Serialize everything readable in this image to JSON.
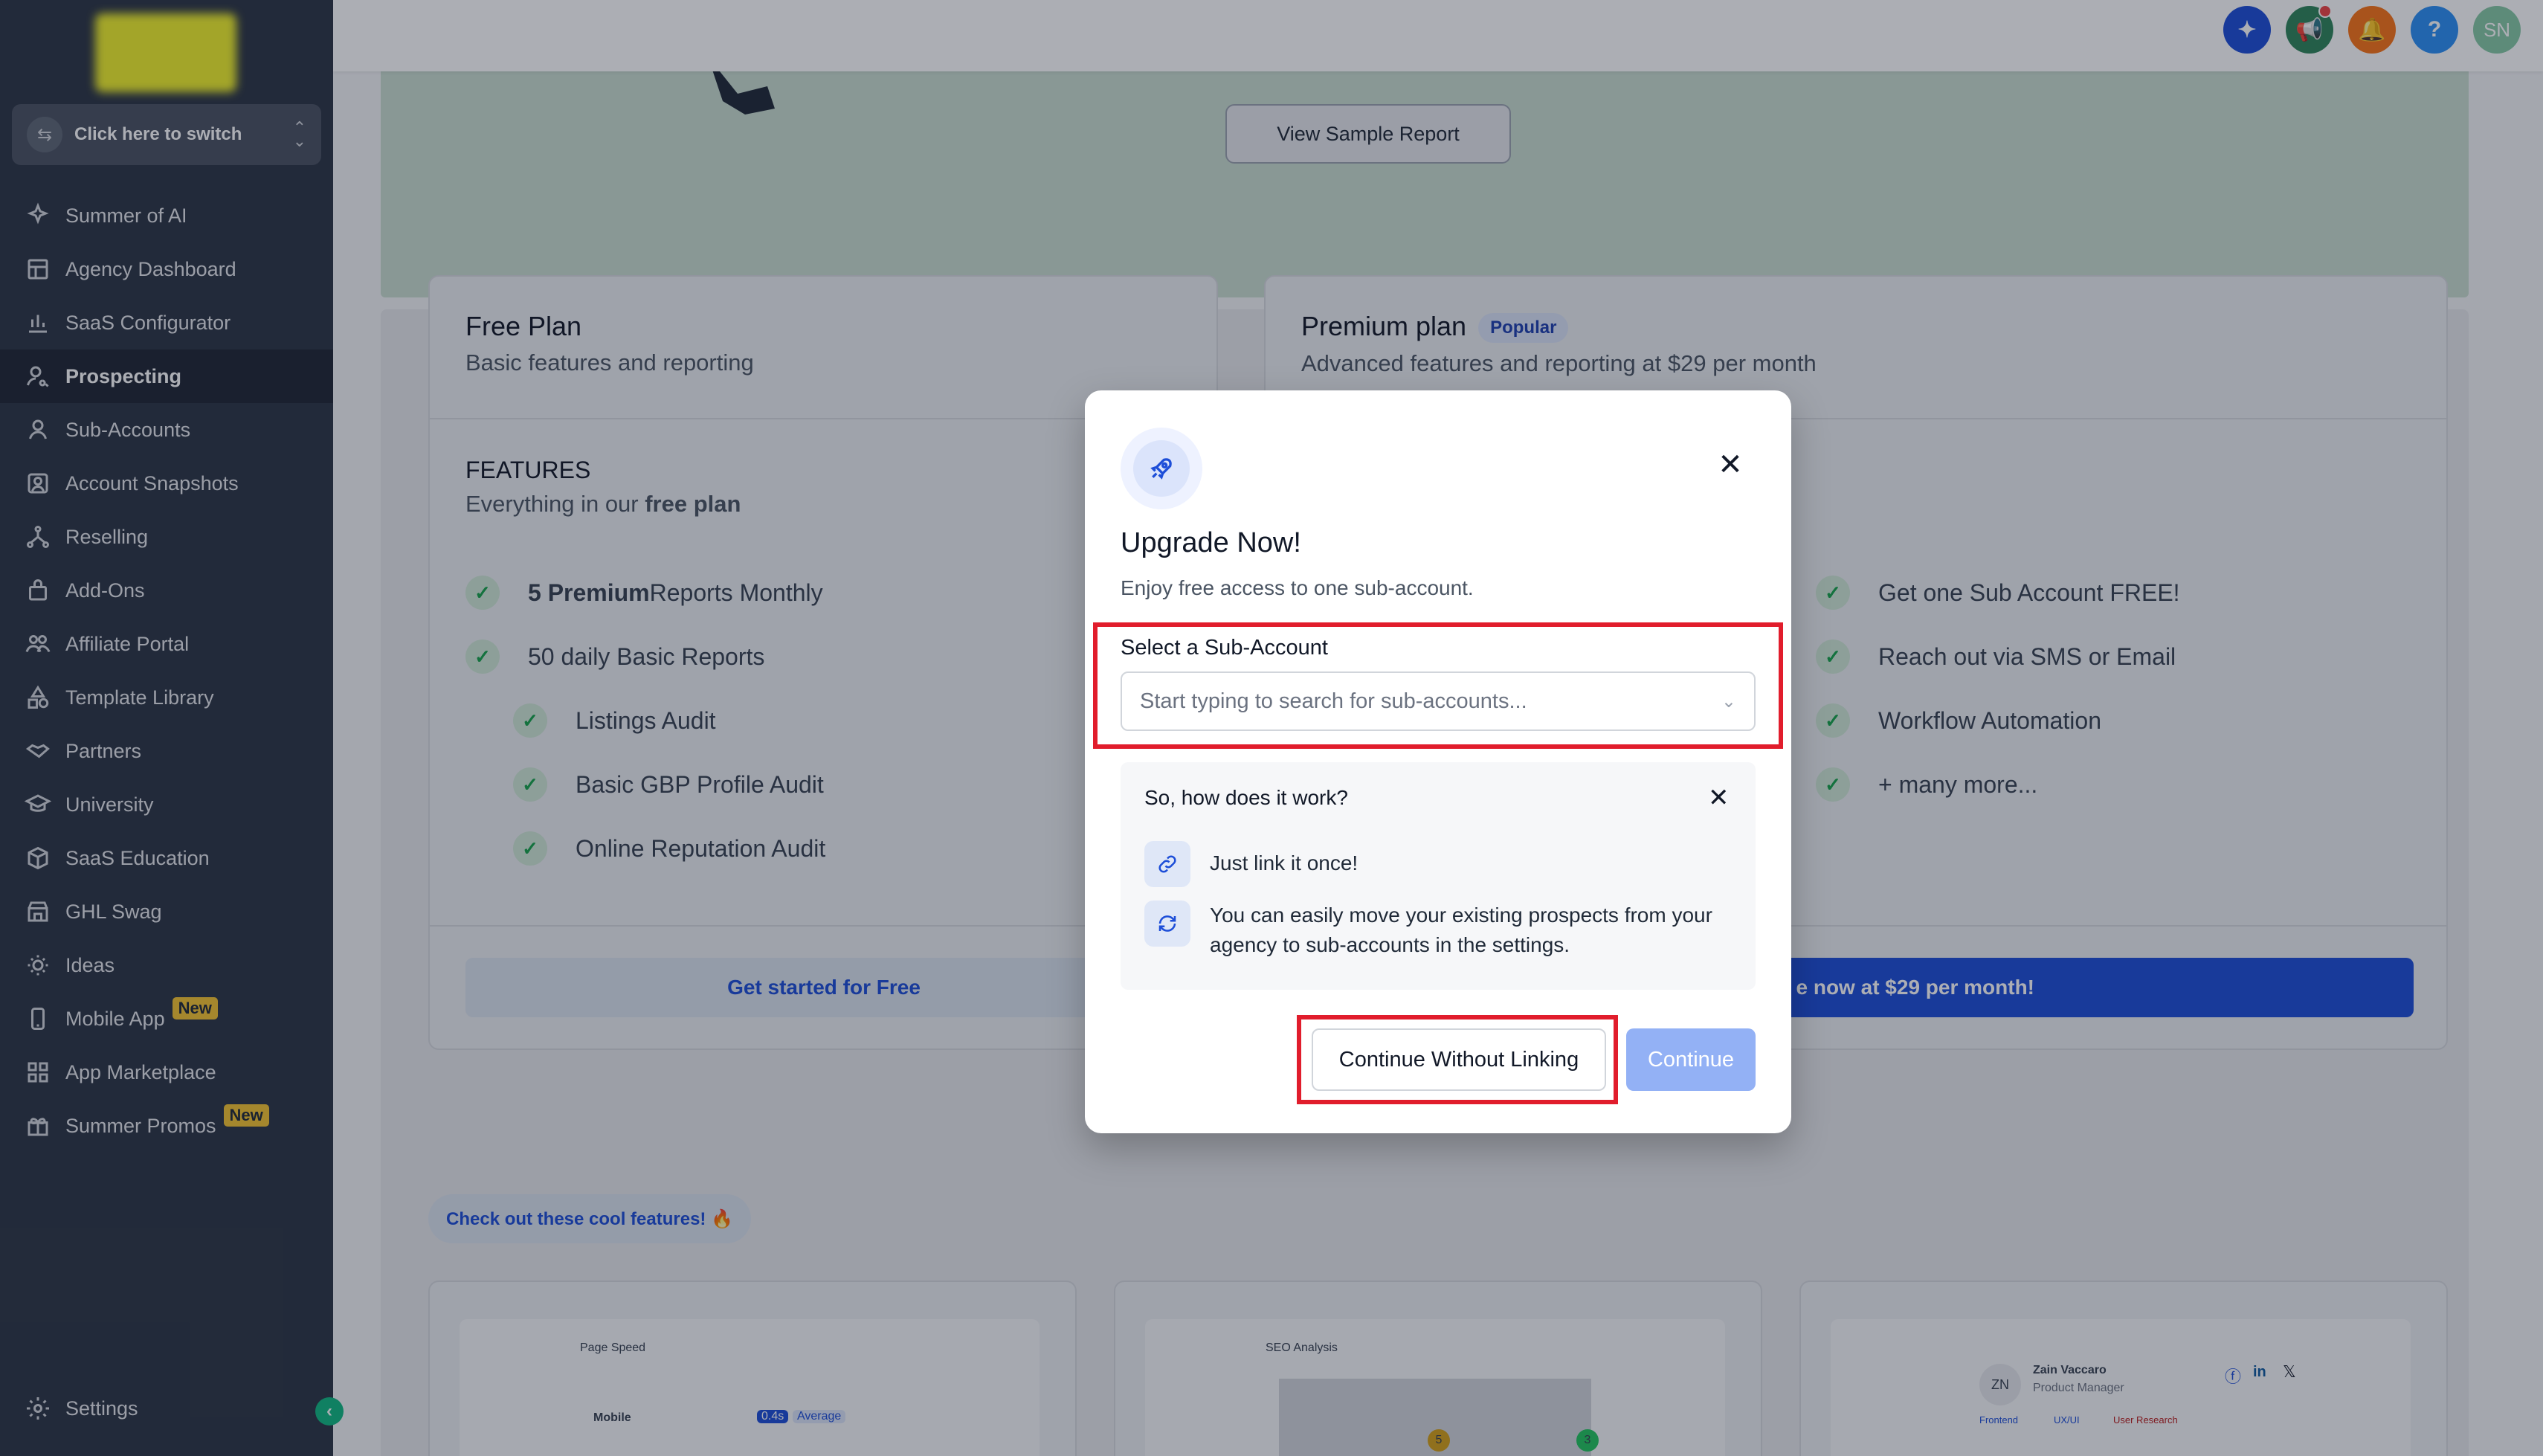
{
  "sidebar": {
    "switcher_label": "Click here to switch",
    "items": [
      {
        "label": "Summer of AI",
        "icon": "sparkle-icon"
      },
      {
        "label": "Agency Dashboard",
        "icon": "dashboard-icon"
      },
      {
        "label": "SaaS Configurator",
        "icon": "chart-icon"
      },
      {
        "label": "Prospecting",
        "icon": "user-search-icon",
        "active": true
      },
      {
        "label": "Sub-Accounts",
        "icon": "user-icon"
      },
      {
        "label": "Account Snapshots",
        "icon": "snapshot-icon"
      },
      {
        "label": "Reselling",
        "icon": "network-icon"
      },
      {
        "label": "Add-Ons",
        "icon": "bag-icon"
      },
      {
        "label": "Affiliate Portal",
        "icon": "users-icon"
      },
      {
        "label": "Template Library",
        "icon": "shapes-icon"
      },
      {
        "label": "Partners",
        "icon": "handshake-icon"
      },
      {
        "label": "University",
        "icon": "graduation-icon"
      },
      {
        "label": "SaaS Education",
        "icon": "box-icon"
      },
      {
        "label": "GHL Swag",
        "icon": "store-icon"
      },
      {
        "label": "Ideas",
        "icon": "bulb-icon"
      },
      {
        "label": "Mobile App",
        "icon": "phone-icon",
        "badge": "New"
      },
      {
        "label": "App Marketplace",
        "icon": "grid-icon"
      },
      {
        "label": "Summer Promos",
        "icon": "gift-icon",
        "badge": "New"
      }
    ],
    "settings_label": "Settings"
  },
  "topbar": {
    "avatar_initials": "SN",
    "help_label": "?",
    "colors": {
      "ai": "#1d4ed8",
      "announce": "#2f855a",
      "bell": "#f97316",
      "help": "#2b8ff5",
      "avatar": "#86c9a5"
    }
  },
  "banner": {
    "sample_button": "View Sample Report"
  },
  "free_plan": {
    "title": "Free Plan",
    "subtitle": "Basic features and reporting",
    "features_heading": "FEATURES",
    "features_sub_prefix": "Everything in our ",
    "features_sub_bold": "free plan",
    "features": [
      {
        "bold": "5 Premium",
        "text": " Reports Monthly",
        "indent": false
      },
      {
        "bold": "",
        "text": "50 daily Basic Reports",
        "indent": false
      },
      {
        "bold": "",
        "text": "Listings Audit",
        "indent": true
      },
      {
        "bold": "",
        "text": "Basic GBP Profile Audit",
        "indent": true
      },
      {
        "bold": "",
        "text": "Online Reputation Audit",
        "indent": true
      }
    ],
    "cta": "Get started for Free"
  },
  "premium_plan": {
    "title": "Premium plan",
    "badge": "Popular",
    "subtitle": "Advanced features and reporting at $29 per month",
    "features": [
      "Get one Sub Account FREE!",
      "Reach out via SMS or Email",
      "Workflow Automation",
      "+ many more..."
    ],
    "cta": "e now at $29 per month!"
  },
  "cool": {
    "pill": "Check out these cool features! 🔥",
    "cards": [
      {
        "title": "Page Speed",
        "row_label": "Mobile",
        "tag1": "0.4s",
        "tag2": "Average"
      },
      {
        "title": "SEO Analysis",
        "pin1": "5",
        "pin2": "3"
      },
      {
        "initials": "ZN",
        "name": "Zain Vaccaro",
        "role": "Product Manager",
        "tags": [
          "Frontend",
          "UX/UI",
          "User Research"
        ]
      }
    ]
  },
  "modal": {
    "title": "Upgrade Now!",
    "subtitle": "Enjoy free access to one sub-account.",
    "select_label": "Select a Sub-Account",
    "select_placeholder": "Start typing to search for sub-accounts...",
    "how": {
      "title": "So, how does it work?",
      "rows": [
        {
          "icon": "link-icon",
          "text": "Just link it once!"
        },
        {
          "icon": "refresh-icon",
          "text": "You can easily move your existing prospects from your agency to sub-accounts in the settings."
        }
      ]
    },
    "skip_button": "Continue Without Linking",
    "continue_button": "Continue",
    "highlight_color": "#e11d2c"
  }
}
